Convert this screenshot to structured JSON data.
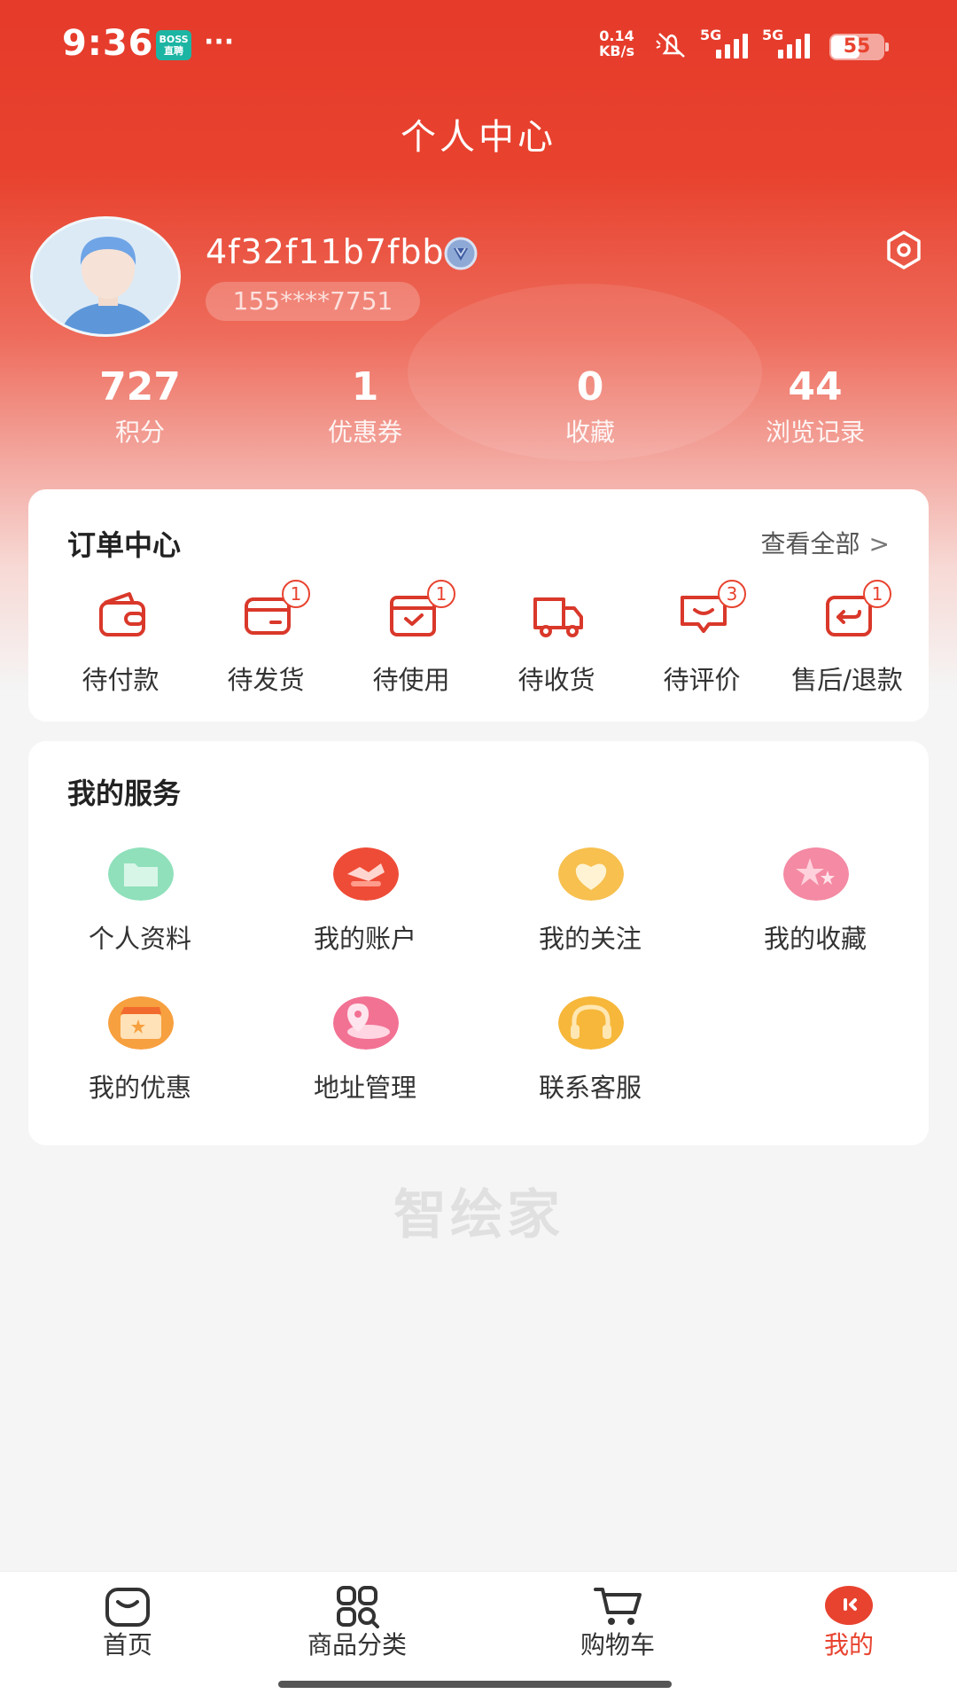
{
  "status_bar": {
    "time": "9:36",
    "app_badge_top": "BOSS",
    "app_badge_bottom": "直聘",
    "more": "···",
    "net_speed_value": "0.14",
    "net_speed_unit": "KB/s",
    "signal1_label": "5G",
    "signal2_label": "5G",
    "battery": "55",
    "battery_level": 0.55
  },
  "header": {
    "title": "个人中心"
  },
  "profile": {
    "username": "4f32f11b7fbb",
    "phone": "155****7751"
  },
  "stats": [
    {
      "value": "727",
      "label": "积分"
    },
    {
      "value": "1",
      "label": "优惠券"
    },
    {
      "value": "0",
      "label": "收藏"
    },
    {
      "value": "44",
      "label": "浏览记录"
    }
  ],
  "orders": {
    "title": "订单中心",
    "view_all": "查看全部",
    "view_all_chevron": ">",
    "items": [
      {
        "label": "待付款",
        "badge": "",
        "icon": "wallet-icon"
      },
      {
        "label": "待发货",
        "badge": "1",
        "icon": "card-icon"
      },
      {
        "label": "待使用",
        "badge": "1",
        "icon": "box-check-icon"
      },
      {
        "label": "待收货",
        "badge": "",
        "icon": "truck-icon"
      },
      {
        "label": "待评价",
        "badge": "3",
        "icon": "comment-icon"
      },
      {
        "label": "售后/退款",
        "badge": "1",
        "icon": "refund-icon"
      }
    ]
  },
  "services": {
    "title": "我的服务",
    "items": [
      {
        "label": "个人资料",
        "icon": "folder-icon",
        "color": "#7fd9b0"
      },
      {
        "label": "我的账户",
        "icon": "account-icon",
        "color": "#f0553f"
      },
      {
        "label": "我的关注",
        "icon": "heart-icon",
        "color": "#f7c35a"
      },
      {
        "label": "我的收藏",
        "icon": "star-icon",
        "color": "#f57c96"
      },
      {
        "label": "我的优惠",
        "icon": "coupon-icon",
        "color": "#f79a3c"
      },
      {
        "label": "地址管理",
        "icon": "location-icon",
        "color": "#f06b8a"
      },
      {
        "label": "联系客服",
        "icon": "headset-icon",
        "color": "#f5b93a"
      }
    ]
  },
  "watermark": "智绘家",
  "tabbar": [
    {
      "label": "首页",
      "icon": "home-bag-icon",
      "active": false
    },
    {
      "label": "商品分类",
      "icon": "category-grid-icon",
      "active": false
    },
    {
      "label": "购物车",
      "icon": "cart-icon",
      "active": false
    },
    {
      "label": "我的",
      "icon": "profile-face-icon",
      "active": true
    }
  ],
  "colors": {
    "brand_red": "#e8432f",
    "background": "#f5f5f5"
  }
}
